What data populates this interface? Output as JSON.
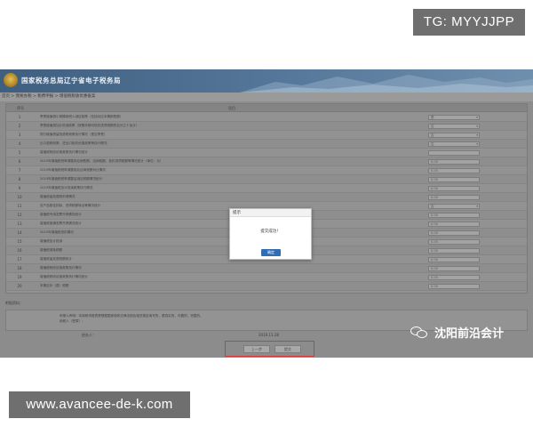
{
  "overlays": {
    "tg_label": "TG: MYYJJPP",
    "url_label": "www.avancee-de-k.com",
    "watermark_text": "沈阳前沿会计",
    "watermark_icon": "wechat-icon"
  },
  "header": {
    "title": "国家税务总局辽宁省电子税务局"
  },
  "breadcrumb": "首页 > 我要办税 > 税费申报 > 增值税税收优惠备案",
  "table": {
    "headers": {
      "index": "序号",
      "item": "项目",
      "value": "",
      "extra": ""
    },
    "rows": [
      {
        "n": "1",
        "text": "享受增值税小规模纳税人减征政策（包括对应本期销售额）",
        "value": "是"
      },
      {
        "n": "2",
        "text": "享受增值税加计抵减政策（按照本期可抵扣进项税额的百分之十加计）",
        "value": "否"
      },
      {
        "n": "3",
        "text": "现行增值税留抵退税政策执行情况（是否享受）",
        "value": "否"
      },
      {
        "n": "4",
        "text": "出口退税政策、进出口相关优惠政策等执行情况",
        "value": "否"
      },
      {
        "n": "5",
        "text": "增值税税收优惠政策执行情况统计",
        "value": ""
      },
      {
        "n": "6",
        "text": "2019年增值税税率调整前后销售额、应纳税额、抵扣进项税额等情况统计（单位：元）",
        "value": "0.00"
      },
      {
        "n": "7",
        "text": "2019年增值税税率调整前后应纳税额对比情况",
        "value": "0.00"
      },
      {
        "n": "8",
        "text": "2019年增值税税率调整后减征税额情况统计",
        "value": "0.00"
      },
      {
        "n": "9",
        "text": "2019年增值税加计抵减政策执行情况",
        "value": "0.00"
      },
      {
        "n": "10",
        "text": "增值税留抵退税申请情况",
        "value": "0.00"
      },
      {
        "n": "11",
        "text": "农产品核定扣除、进项税额转出等情况统计",
        "value": "否"
      },
      {
        "n": "12",
        "text": "增值税专用发票开具情况统计",
        "value": "0.00"
      },
      {
        "n": "13",
        "text": "增值税普通发票开具情况统计",
        "value": "0.00"
      },
      {
        "n": "14",
        "text": "2019年增值税抵扣情况",
        "value": "0.00"
      },
      {
        "n": "15",
        "text": "增值税加计抵减",
        "value": "0.00"
      },
      {
        "n": "16",
        "text": "增值税减免税额",
        "value": "0.00"
      },
      {
        "n": "17",
        "text": "增值税留抵退税额统计",
        "value": "0.00"
      },
      {
        "n": "18",
        "text": "增值税税收优惠政策执行情况",
        "value": "0.00"
      },
      {
        "n": "19",
        "text": "增值税税收优惠政策执行情况统计",
        "value": "0.00"
      },
      {
        "n": "20",
        "text": "本期应补（退）税额",
        "value": "0.00"
      }
    ]
  },
  "upload": {
    "label": "附报资料："
  },
  "note": {
    "line1": "申报人声明：本纳税申报表是根据国家税收法律法规及相关规定填写的，是真实的、可靠的、完整的。",
    "line2": "纳税人（签章）：",
    "line3": ""
  },
  "sign": {
    "label": "经办人：",
    "date": "2019.11.28"
  },
  "actions": {
    "prev": "上一步",
    "submit": "提交"
  },
  "dialog": {
    "title": "提示",
    "message": "提交成功！",
    "ok": "确定"
  },
  "colors": {
    "highlight_border": "#d23b3b",
    "dialog_button": "#2f6db5",
    "header_bg": "#4a6c90"
  }
}
